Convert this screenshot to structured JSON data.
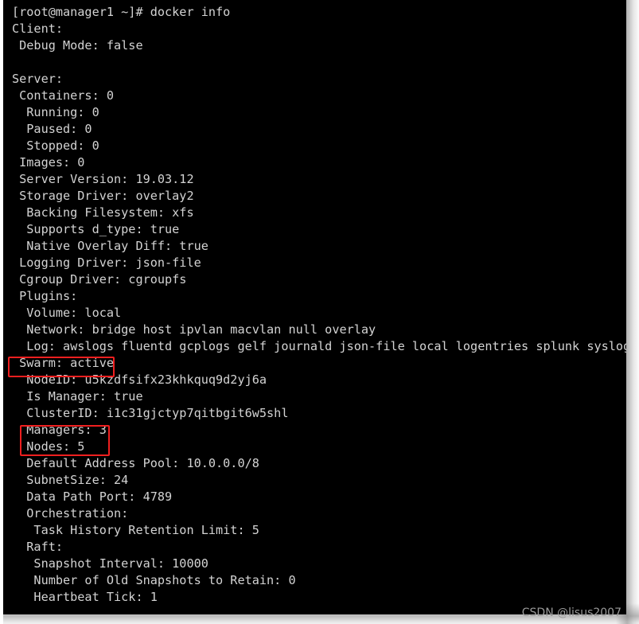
{
  "terminal": {
    "prompt_line": "[root@manager1 ~]# docker info",
    "command": "docker info",
    "background_color": "#000000",
    "text_color": "#d3d3d3",
    "lines": [
      "[root@manager1 ~]# docker info",
      "Client:",
      " Debug Mode: false",
      "",
      "Server:",
      " Containers: 0",
      "  Running: 0",
      "  Paused: 0",
      "  Stopped: 0",
      " Images: 0",
      " Server Version: 19.03.12",
      " Storage Driver: overlay2",
      "  Backing Filesystem: xfs",
      "  Supports d_type: true",
      "  Native Overlay Diff: true",
      " Logging Driver: json-file",
      " Cgroup Driver: cgroupfs",
      " Plugins:",
      "  Volume: local",
      "  Network: bridge host ipvlan macvlan null overlay",
      "  Log: awslogs fluentd gcplogs gelf journald json-file local logentries splunk syslog",
      " Swarm: active",
      "  NodeID: u5kzdfsifx23khkquq9d2yj6a",
      "  Is Manager: true",
      "  ClusterID: i1c31gjctyp7qitbgit6w5shl",
      "  Managers: 3",
      "  Nodes: 5",
      "  Default Address Pool: 10.0.0.0/8",
      "  SubnetSize: 24",
      "  Data Path Port: 4789",
      "  Orchestration:",
      "   Task History Retention Limit: 5",
      "  Raft:",
      "   Snapshot Interval: 10000",
      "   Number of Old Snapshots to Retain: 0",
      "   Heartbeat Tick: 1"
    ]
  },
  "annotations": {
    "color": "#f01f1f",
    "boxes": [
      {
        "label": "Swarm: active",
        "target": "swarm-status-line"
      },
      {
        "label": "Managers: 3 / Nodes: 5",
        "target": "managers-nodes-lines"
      }
    ]
  },
  "watermark": {
    "text": "CSDN @lisus2007",
    "color": "#9a9a9a"
  }
}
